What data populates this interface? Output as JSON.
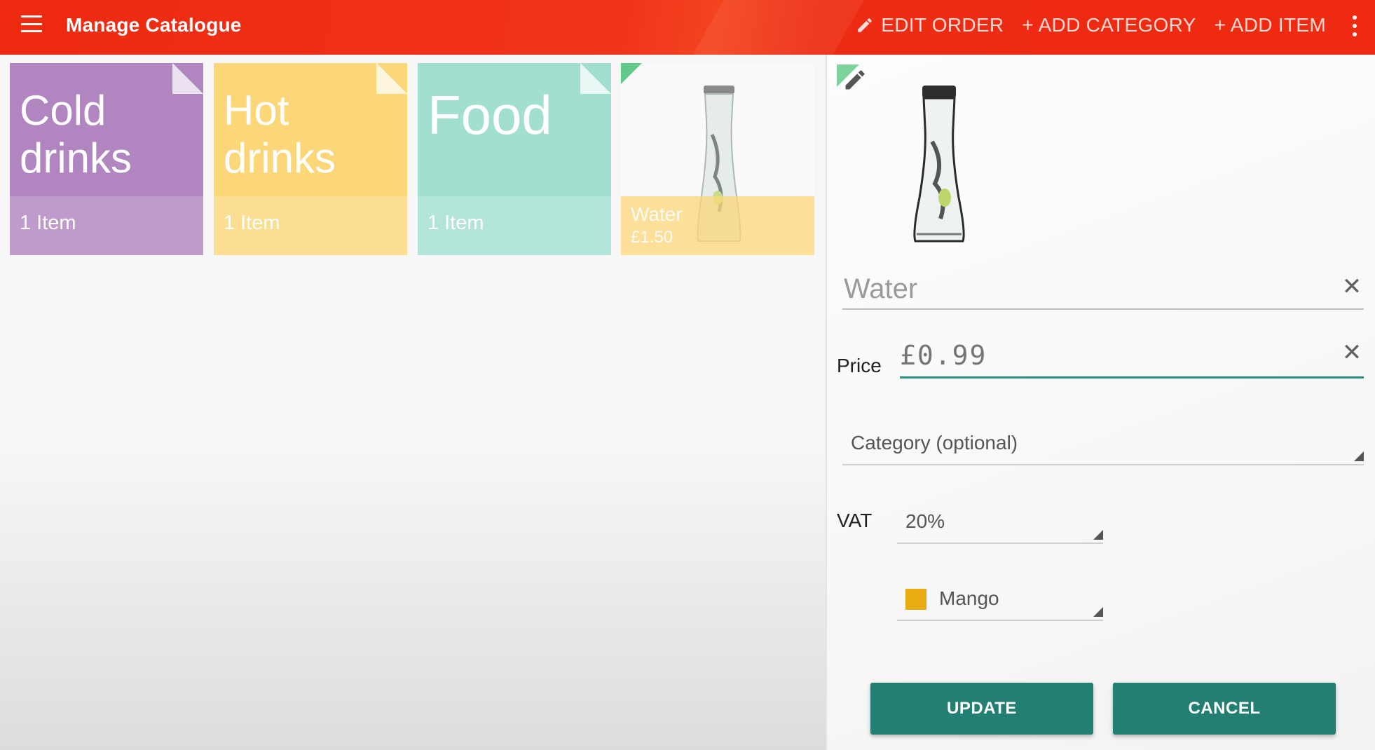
{
  "appbar": {
    "title": "Manage Catalogue",
    "actions": {
      "edit_order": "EDIT ORDER",
      "add_category": "+ ADD CATEGORY",
      "add_item": "+ ADD ITEM"
    },
    "colors": {
      "background": "#ee2a10",
      "text": "#ffffff"
    }
  },
  "tiles": [
    {
      "name": "Cold drinks",
      "line1": "Cold",
      "line2": "drinks",
      "count": "1 Item",
      "color": "#b085c0"
    },
    {
      "name": "Hot drinks",
      "line1": "Hot",
      "line2": "drinks",
      "count": "1 Item",
      "color": "#fcd77a"
    },
    {
      "name": "Food",
      "line1": "Food",
      "line2": "",
      "count": "1 Item",
      "color": "#a2dfd1"
    },
    {
      "name": "Water",
      "price": "£1.50",
      "color": "#fcd77a"
    }
  ],
  "edit_panel": {
    "item_name": "Water",
    "price_label": "Price",
    "price_value": "£0.99",
    "category_placeholder": "Category (optional)",
    "vat_label": "VAT",
    "vat_value": "20%",
    "color_name": "Mango",
    "color_swatch": "#e8ac12",
    "update_label": "UPDATE",
    "cancel_label": "CANCEL",
    "accent": "#237f72"
  },
  "icons": {
    "menu": "hamburger-icon",
    "edit": "pencil-icon",
    "overflow": "more-vertical-icon",
    "clear": "close-icon",
    "dropdown": "triangle-caret-icon"
  }
}
